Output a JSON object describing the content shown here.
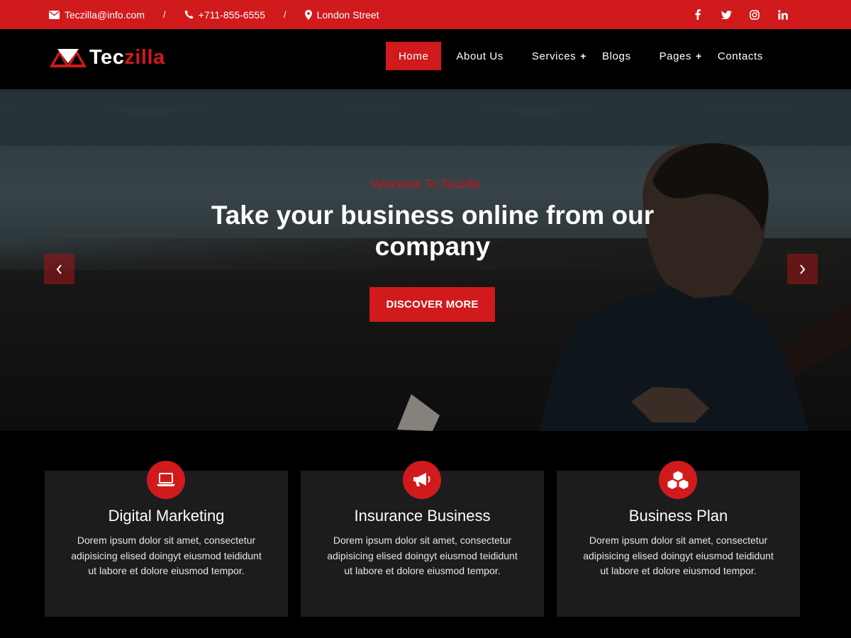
{
  "topbar": {
    "email": "Teczilla@info.com",
    "phone": "+711-855-6555",
    "address": "London Street",
    "separator": "/",
    "social": [
      "facebook-icon",
      "twitter-icon",
      "instagram-icon",
      "linkedin-icon"
    ]
  },
  "header": {
    "brand_white": "Tec",
    "brand_red": "zilla",
    "nav": [
      {
        "label": "Home",
        "active": true
      },
      {
        "label": "About Us"
      },
      {
        "label": "Services",
        "dropdown": true
      },
      {
        "label": "Blogs"
      },
      {
        "label": "Pages",
        "dropdown": true
      },
      {
        "label": "Contacts"
      }
    ],
    "dropdown_symbol": "+"
  },
  "hero": {
    "subtitle": "Welcome To Teczilla",
    "title": "Take your business online from our company",
    "cta": "DISCOVER MORE"
  },
  "services": [
    {
      "icon": "laptop-icon",
      "title": "Digital Marketing",
      "text": "Dorem ipsum dolor sit amet, consectetur adipisicing elised doingyt eiusmod teididunt ut labore et dolore eiusmod tempor."
    },
    {
      "icon": "megaphone-icon",
      "title": "Insurance Business",
      "text": "Dorem ipsum dolor sit amet, consectetur adipisicing elised doingyt eiusmod teididunt ut labore et dolore eiusmod tempor."
    },
    {
      "icon": "cubes-icon",
      "title": "Business Plan",
      "text": "Dorem ipsum dolor sit amet, consectetur adipisicing elised doingyt eiusmod teididunt ut labore et dolore eiusmod tempor."
    }
  ],
  "colors": {
    "accent": "#d01a1c",
    "card_bg": "#1c1c1c",
    "background": "#000000"
  }
}
